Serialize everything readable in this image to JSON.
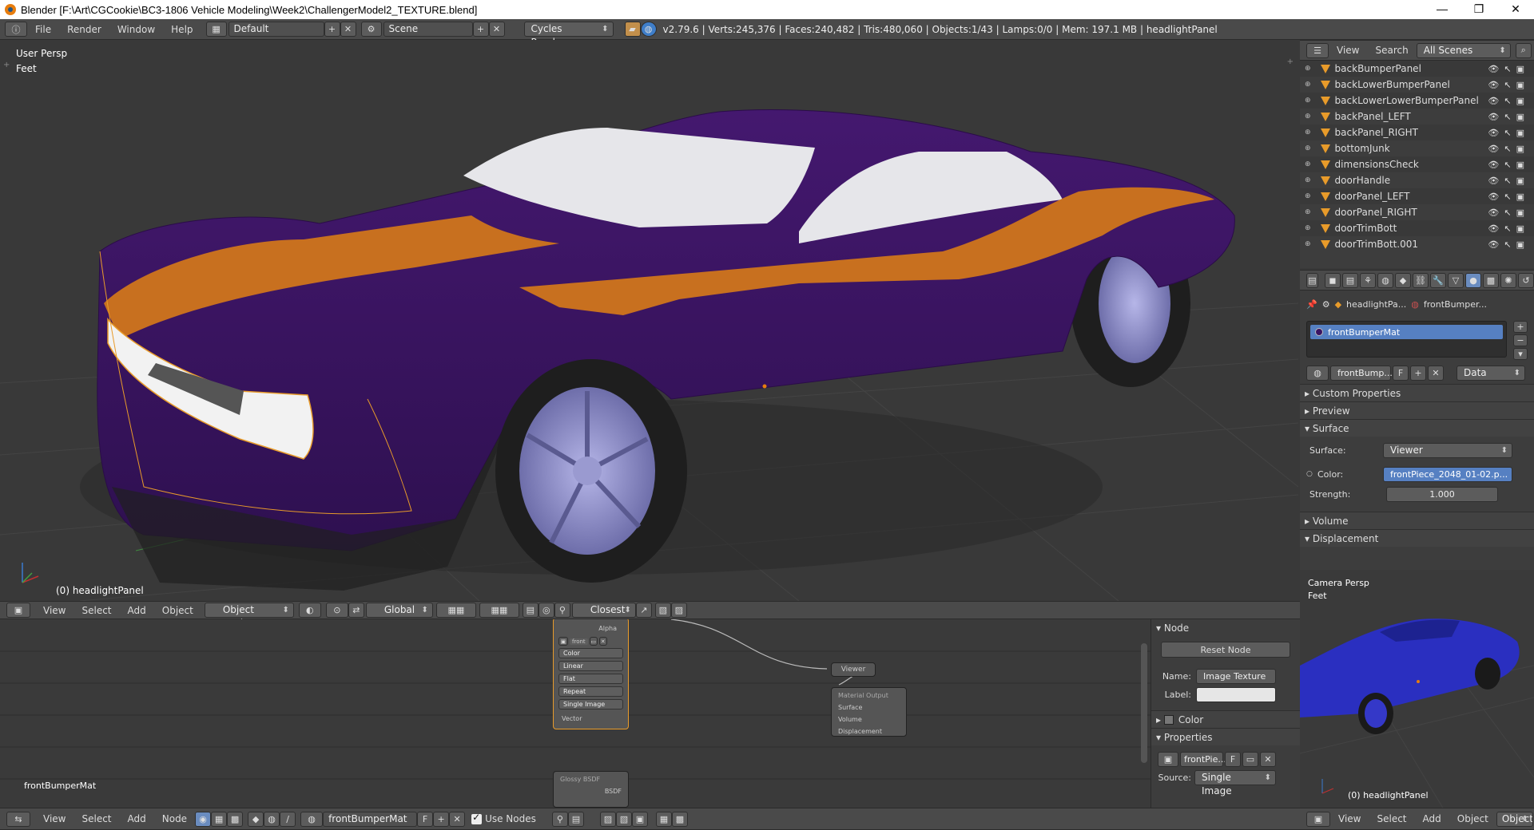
{
  "window": {
    "title": "Blender  [F:\\Art\\CGCookie\\BC3-1806 Vehicle Modeling\\Week2\\ChallengerModel2_TEXTURE.blend]",
    "min": "—",
    "max": "❐",
    "close": "✕"
  },
  "infobar": {
    "menus": [
      "File",
      "Render",
      "Window",
      "Help"
    ],
    "layout": "Default",
    "scene": "Scene",
    "engine": "Cycles Render",
    "stats": "v2.79.6 | Verts:245,376 | Faces:240,482 | Tris:480,060 | Objects:1/43 | Lamps:0/0 | Mem: 197.1 MB | headlightPanel"
  },
  "viewport": {
    "view_name": "User Persp",
    "units": "Feet",
    "active_object": "(0) headlightPanel"
  },
  "viewport_header": {
    "menus": [
      "View",
      "Select",
      "Add",
      "Object"
    ],
    "mode": "Object Mode",
    "orientation": "Global",
    "snap": "Closest"
  },
  "outliner": {
    "header_menus": [
      "View",
      "Search"
    ],
    "filter": "All Scenes",
    "items": [
      "backBumperPanel",
      "backLowerBumperPanel",
      "backLowerLowerBumperPanel",
      "backPanel_LEFT",
      "backPanel_RIGHT",
      "bottomJunk",
      "dimensionsCheck",
      "doorHandle",
      "doorPanel_LEFT",
      "doorPanel_RIGHT",
      "doorTrimBott",
      "doorTrimBott.001"
    ]
  },
  "properties": {
    "breadcrumb_object": "headlightPa...",
    "breadcrumb_material": "frontBumper...",
    "material_slot": "frontBumperMat",
    "material_name": "frontBump...",
    "fake_user": "F",
    "link": "Data",
    "panels": {
      "custom_properties": "Custom Properties",
      "preview": "Preview",
      "surface": "Surface",
      "volume": "Volume",
      "displacement": "Displacement"
    },
    "surface_label": "Surface:",
    "surface_value": "Viewer",
    "color_label": "Color:",
    "color_value": "frontPiece_2048_01-02.p...",
    "strength_label": "Strength:",
    "strength_value": "1.000"
  },
  "camera_view": {
    "view_name": "Camera Persp",
    "units": "Feet",
    "active_object": "(0) headlightPanel"
  },
  "node_editor": {
    "material_label": "frontBumperMat",
    "image_node": {
      "output": "Alpha",
      "image": "front",
      "fields": [
        "Color",
        "Linear",
        "Flat",
        "Repeat",
        "Single Image"
      ],
      "input": "Vector"
    },
    "viewer_node": "Viewer",
    "output_node": {
      "title": "Material Output",
      "sockets": [
        "Surface",
        "Volume",
        "Displacement"
      ]
    },
    "glossy_node": {
      "title": "Glossy BSDF",
      "output": "BSDF"
    }
  },
  "node_side": {
    "node_panel": "Node",
    "reset_button": "Reset Node",
    "name_label": "Name:",
    "name_value": "Image Texture",
    "label_label": "Label:",
    "color_panel": "Color",
    "properties_panel": "Properties",
    "image_name": "frontPie...",
    "fake_user": "F",
    "source_label": "Source:",
    "source_value": "Single Image"
  },
  "bottom_bar": {
    "menus": [
      "View",
      "Select",
      "Add",
      "Node"
    ],
    "material": "frontBumperMat",
    "fake_user": "F",
    "use_nodes": "Use Nodes"
  },
  "bottom_bar2": {
    "menus": [
      "View",
      "Select",
      "Add",
      "Object"
    ],
    "mode": "Object"
  },
  "colors": {
    "car_body": "#3a1463",
    "stripe": "#c8701f",
    "glass": "#e6e6ea",
    "wheel": "#8c8ccc",
    "selection": "#e89b2a",
    "camera_car": "#2a2fc0",
    "slot_highlight": "#5680c2"
  }
}
